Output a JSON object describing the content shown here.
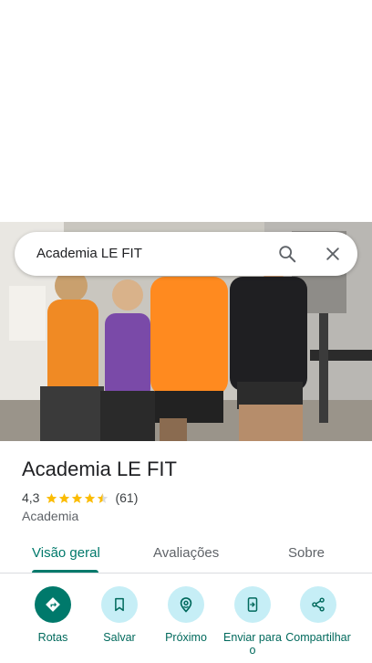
{
  "search": {
    "query": "Academia LE FIT",
    "search_icon": "search-icon",
    "close_icon": "close-icon"
  },
  "place": {
    "name": "Academia LE FIT",
    "rating": "4,3",
    "rating_value": 4.3,
    "review_count": "(61)",
    "category": "Academia"
  },
  "tabs": [
    {
      "label": "Visão geral",
      "active": true
    },
    {
      "label": "Avaliações",
      "active": false
    },
    {
      "label": "Sobre",
      "active": false
    }
  ],
  "actions": [
    {
      "label": "Rotas",
      "icon": "directions-icon"
    },
    {
      "label": "Salvar",
      "icon": "bookmark-icon"
    },
    {
      "label": "Próximo",
      "icon": "nearby-icon"
    },
    {
      "label": "Enviar para o",
      "icon": "send-to-phone-icon"
    },
    {
      "label": "Compartilhar",
      "icon": "share-icon"
    }
  ],
  "colors": {
    "accent": "#00796b",
    "action_bg": "#c6eef6",
    "star": "#fbbc04"
  }
}
